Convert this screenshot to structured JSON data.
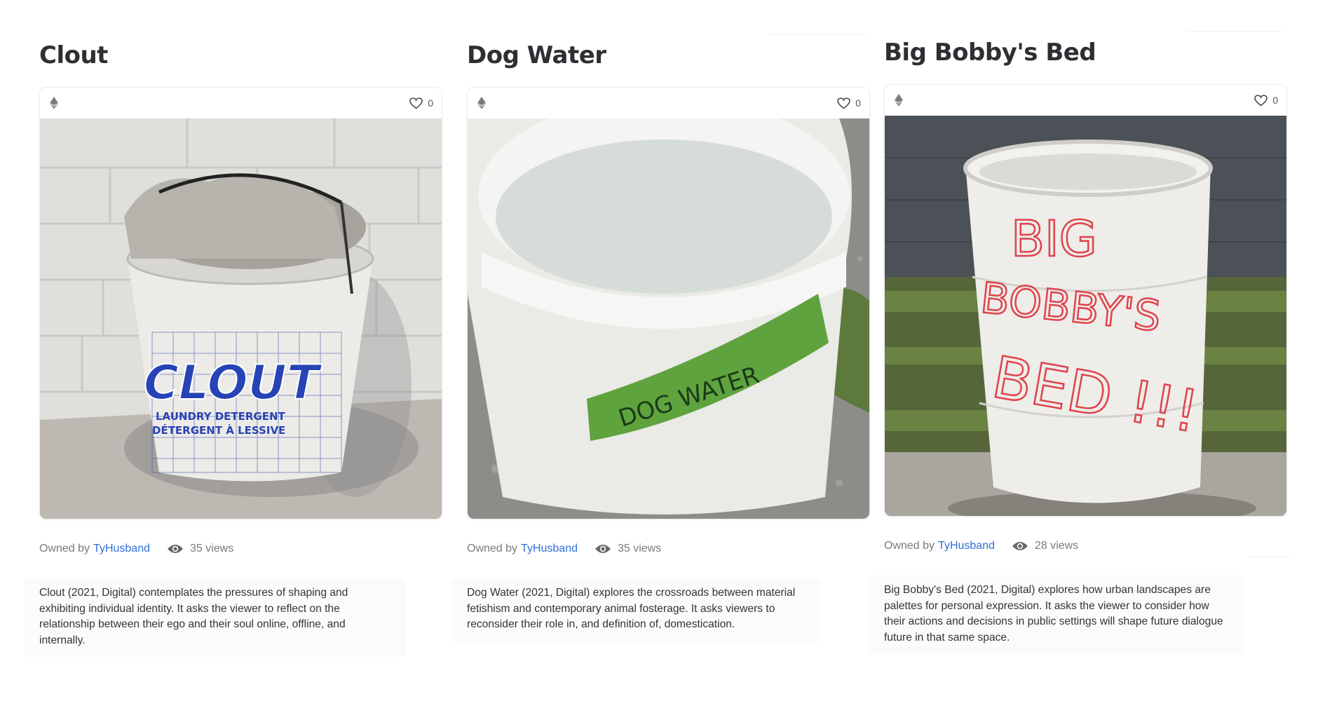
{
  "cards": [
    {
      "title": "Clout",
      "likes": "0",
      "owned_by_label": "Owned by",
      "owner": "TyHusband",
      "views": "35 views",
      "description": "Clout (2021, Digital) contemplates the pressures of shaping and exhibiting individual identity. It asks the viewer to reflect on the relationship between their ego and their soul online, offline, and internally.",
      "image_text": {
        "brand": "CLOUT",
        "line1": "LAUNDRY DETERGENT",
        "line2": "DÉTERGENT À LESSIVE"
      }
    },
    {
      "title": "Dog Water",
      "likes": "0",
      "owned_by_label": "Owned by",
      "owner": "TyHusband",
      "views": "35 views",
      "description": "Dog Water (2021, Digital) explores the crossroads between material fetishism and contemporary animal fosterage. It asks viewers to reconsider their role in, and definition of, domestication.",
      "image_text": {
        "tape": "DOG WATER"
      }
    },
    {
      "title": "Big Bobby's Bed",
      "likes": "0",
      "owned_by_label": "Owned by",
      "owner": "TyHusband",
      "views": "28 views",
      "description": "Big Bobby's Bed (2021, Digital) explores how urban landscapes are palettes for personal expression. It asks the viewer to consider how their actions and decisions in public settings will shape future dialogue future in that same space.",
      "image_text": {
        "line1": "BIG",
        "line2": "BOBBY'S",
        "line3": "BED !!!"
      }
    }
  ],
  "colors": {
    "link": "#2f6fd6",
    "title": "#2e2e33",
    "muted": "#7a7a7a"
  },
  "icons": {
    "network": "ethereum-icon",
    "likes": "heart-icon",
    "views": "eye-icon"
  }
}
